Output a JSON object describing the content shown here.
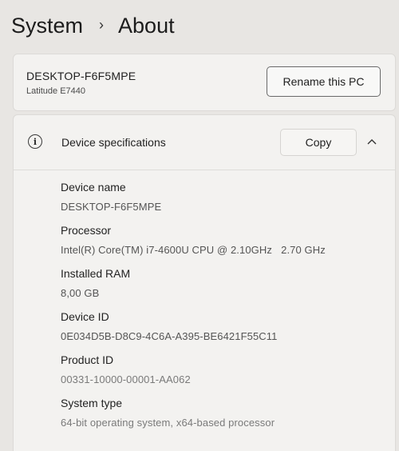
{
  "breadcrumb": {
    "parent": "System",
    "separator": "›",
    "current": "About"
  },
  "pc": {
    "name": "DESKTOP-F6F5MPE",
    "model": "Latitude E7440",
    "rename_label": "Rename this PC"
  },
  "device_specs": {
    "icon": "info-icon",
    "icon_glyph": "i",
    "title": "Device specifications",
    "copy_label": "Copy",
    "expanded": true,
    "items": [
      {
        "label": "Device name",
        "value": "DESKTOP-F6F5MPE"
      },
      {
        "label": "Processor",
        "value": "Intel(R) Core(TM) i7-4600U CPU @ 2.10GHz   2.70 GHz"
      },
      {
        "label": "Installed RAM",
        "value": "8,00 GB"
      },
      {
        "label": "Device ID",
        "value": "0E034D5B-D8C9-4C6A-A395-BE6421F55C11"
      },
      {
        "label": "Product ID",
        "value": "00331-10000-00001-AA062"
      },
      {
        "label": "System type",
        "value": "64-bit operating system, x64-based processor"
      }
    ]
  },
  "colors": {
    "background": "#e8e6e3",
    "card": "#f3f2f0",
    "text_primary": "#1f1f1f",
    "text_secondary": "#555555"
  }
}
